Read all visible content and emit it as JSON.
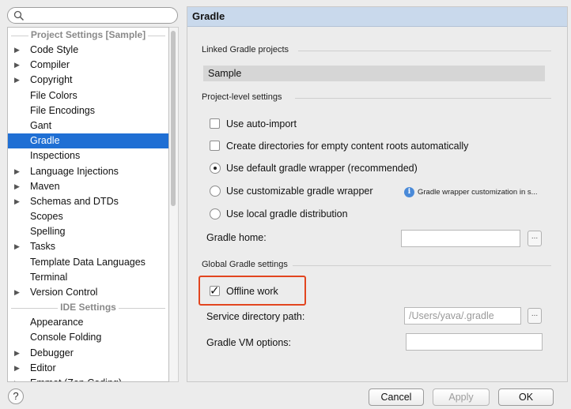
{
  "search": {
    "placeholder": ""
  },
  "tree": {
    "project_section": "Project Settings [Sample]",
    "project_items": [
      {
        "label": "Code Style",
        "arrow": true
      },
      {
        "label": "Compiler",
        "arrow": true
      },
      {
        "label": "Copyright",
        "arrow": true
      },
      {
        "label": "File Colors",
        "arrow": false
      },
      {
        "label": "File Encodings",
        "arrow": false
      },
      {
        "label": "Gant",
        "arrow": false
      },
      {
        "label": "Gradle",
        "arrow": false,
        "selected": true
      },
      {
        "label": "Inspections",
        "arrow": false
      },
      {
        "label": "Language Injections",
        "arrow": true
      },
      {
        "label": "Maven",
        "arrow": true
      },
      {
        "label": "Schemas and DTDs",
        "arrow": true
      },
      {
        "label": "Scopes",
        "arrow": false
      },
      {
        "label": "Spelling",
        "arrow": false
      },
      {
        "label": "Tasks",
        "arrow": true
      },
      {
        "label": "Template Data Languages",
        "arrow": false
      },
      {
        "label": "Terminal",
        "arrow": false
      },
      {
        "label": "Version Control",
        "arrow": true
      }
    ],
    "ide_section": "IDE Settings",
    "ide_items": [
      {
        "label": "Appearance",
        "arrow": false
      },
      {
        "label": "Console Folding",
        "arrow": false
      },
      {
        "label": "Debugger",
        "arrow": true
      },
      {
        "label": "Editor",
        "arrow": true
      },
      {
        "label": "Emmet (Zen Coding)",
        "arrow": true
      }
    ]
  },
  "panel": {
    "title": "Gradle",
    "linked_group": "Linked Gradle projects",
    "linked_project": "Sample",
    "project_level_group": "Project-level settings",
    "auto_import": {
      "label": "Use auto-import",
      "checked": false
    },
    "create_dirs": {
      "label": "Create directories for empty content roots automatically",
      "checked": false
    },
    "wrapper_options": [
      {
        "label": "Use default gradle wrapper (recommended)",
        "selected": true
      },
      {
        "label": "Use customizable gradle wrapper",
        "selected": false
      },
      {
        "label": "Use local gradle distribution",
        "selected": false
      }
    ],
    "info_text": "Gradle wrapper customization in s...",
    "gradle_home_label": "Gradle home:",
    "gradle_home_value": "",
    "global_group": "Global Gradle settings",
    "offline_work": {
      "label": "Offline work",
      "checked": true
    },
    "service_dir_label": "Service directory path:",
    "service_dir_value": "/Users/yava/.gradle",
    "vm_options_label": "Gradle VM options:",
    "vm_options_value": "",
    "browse_glyph": "..."
  },
  "buttons": {
    "cancel": "Cancel",
    "apply": "Apply",
    "ok": "OK",
    "help": "?"
  },
  "colors": {
    "selection": "#1f6fd4",
    "highlight": "#e2451f",
    "header": "#c9d9ec"
  }
}
